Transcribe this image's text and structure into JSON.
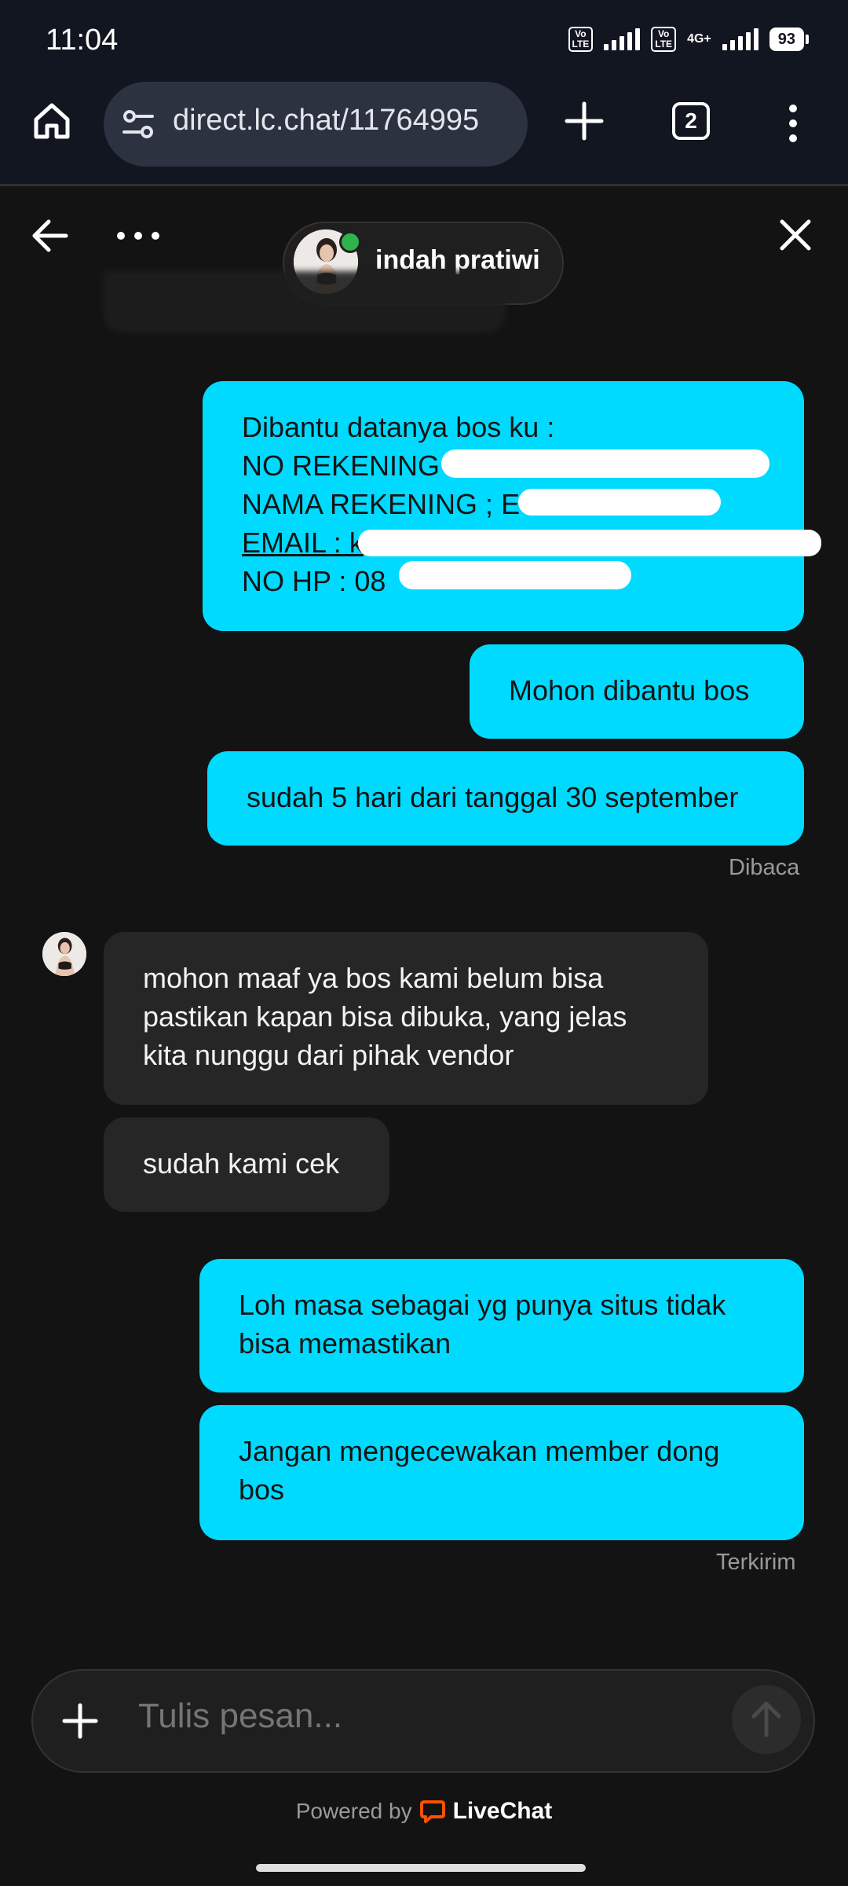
{
  "status_bar": {
    "time": "11:04",
    "volte_1": "Vo LTE",
    "volte_2": "Vo LTE",
    "network": "4G+",
    "battery": "93"
  },
  "browser": {
    "url": "direct.lc.chat/11764995",
    "tab_count": "2"
  },
  "chat_header": {
    "agent_name": "indah pratiwi",
    "agent_status_color": "#2fb34a"
  },
  "messages": {
    "m1": {
      "line1": "Dibantu datanya bos ku :",
      "line2": "NO REKENING :",
      "line3": "NAMA REKENING ; E",
      "line4": "EMAIL : k",
      "line5": "NO HP : 08"
    },
    "m2": "Mohon dibantu bos",
    "m3": "sudah 5 hari dari tanggal 30 september",
    "status_read": "Dibaca",
    "m4": {
      "line1": "mohon maaf ya bos kami belum bisa",
      "line2": "pastikan kapan bisa dibuka, yang jelas",
      "line3": "kita nunggu dari pihak vendor"
    },
    "m5": "sudah kami cek",
    "m6": {
      "line1": "Loh masa sebagai yg punya situs tidak",
      "line2": "bisa memastikan"
    },
    "m7": {
      "line1": "Jangan mengecewakan member dong",
      "line2": "bos"
    },
    "status_sent": "Terkirim"
  },
  "composer": {
    "placeholder": "Tulis pesan..."
  },
  "footer": {
    "powered_by": "Powered by",
    "brand": "LiveChat",
    "brand_color": "#ff5100"
  },
  "colors": {
    "outgoing_bubble": "#00daff",
    "incoming_bubble": "#262626",
    "background": "#131313"
  }
}
